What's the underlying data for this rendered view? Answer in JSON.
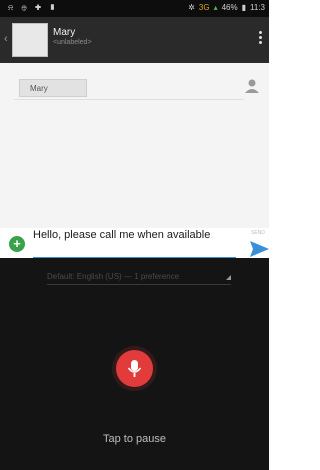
{
  "status": {
    "left_icons": "⍾ ⊕ ✚ ▮",
    "network": "3G",
    "battery": "46%",
    "time": "11:3"
  },
  "header": {
    "contact_name": "Mary",
    "contact_sub": "<unlabeled>"
  },
  "recipient": {
    "chip_label": "Mary"
  },
  "compose": {
    "message": "Hello, please call me when available",
    "send_label": "SEND"
  },
  "voice": {
    "language": "Default: English (US) — 1 preference",
    "tap_label": "Tap to pause"
  },
  "colors": {
    "accent": "#3a8fd6",
    "mic": "#e23b3b",
    "plus": "#3aa24b"
  }
}
